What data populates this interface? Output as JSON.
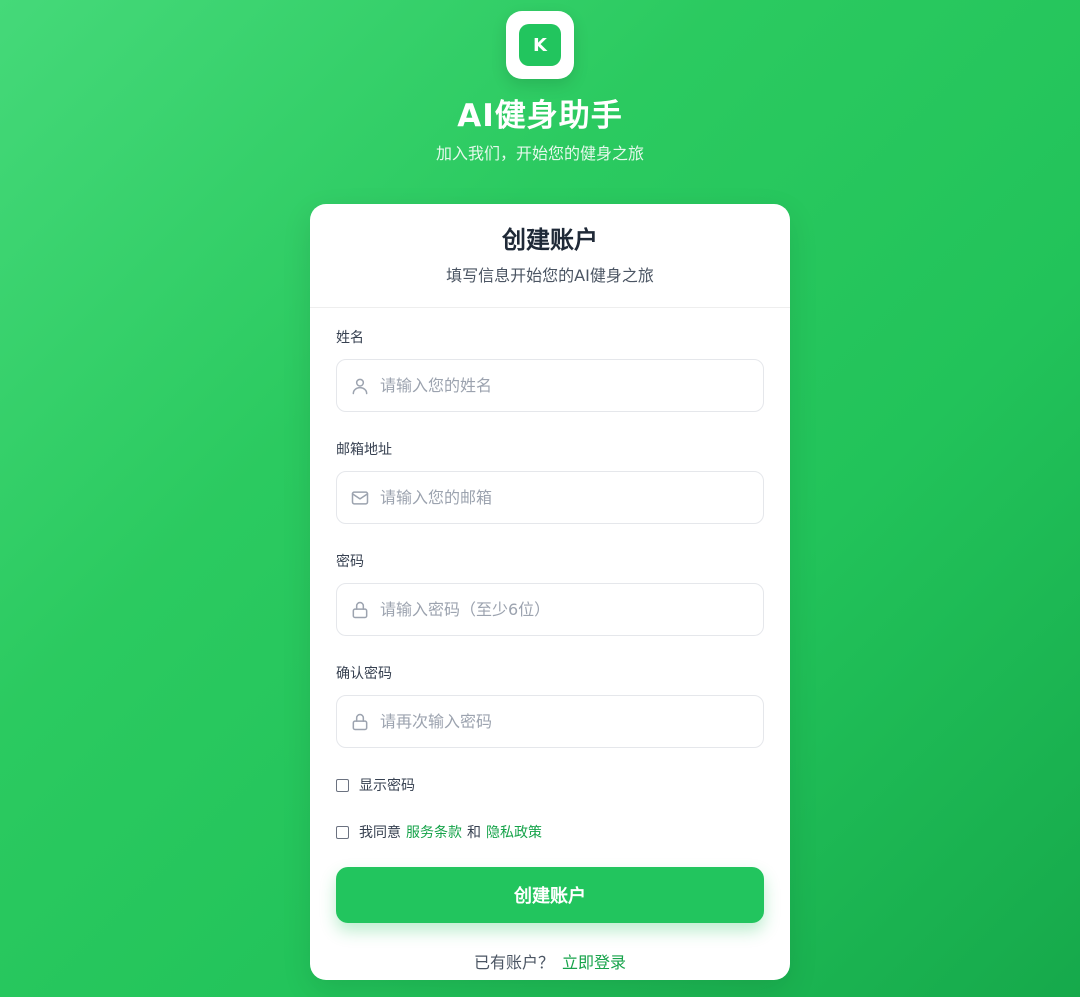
{
  "brand": {
    "logo_letter": "K",
    "title": "AI健身助手",
    "subtitle": "加入我们，开始您的健身之旅"
  },
  "card": {
    "title": "创建账户",
    "subtitle": "填写信息开始您的AI健身之旅"
  },
  "fields": [
    {
      "label": "姓名",
      "placeholder": "请输入您的姓名",
      "icon": "user-icon"
    },
    {
      "label": "邮箱地址",
      "placeholder": "请输入您的邮箱",
      "icon": "mail-icon"
    },
    {
      "label": "密码",
      "placeholder": "请输入密码（至少6位）",
      "icon": "lock-icon"
    },
    {
      "label": "确认密码",
      "placeholder": "请再次输入密码",
      "icon": "lock-icon"
    }
  ],
  "options": {
    "show_password": "显示密码",
    "agree_prefix": "我同意",
    "terms_link": "服务条款",
    "and_text": "和",
    "privacy_link": "隐私政策"
  },
  "submit_label": "创建账户",
  "login": {
    "prompt": "已有账户？",
    "link": "立即登录"
  },
  "colors": {
    "accent": "#22c55e",
    "link": "#16a34a",
    "background_start": "#45d979",
    "background_end": "#16a94b"
  }
}
